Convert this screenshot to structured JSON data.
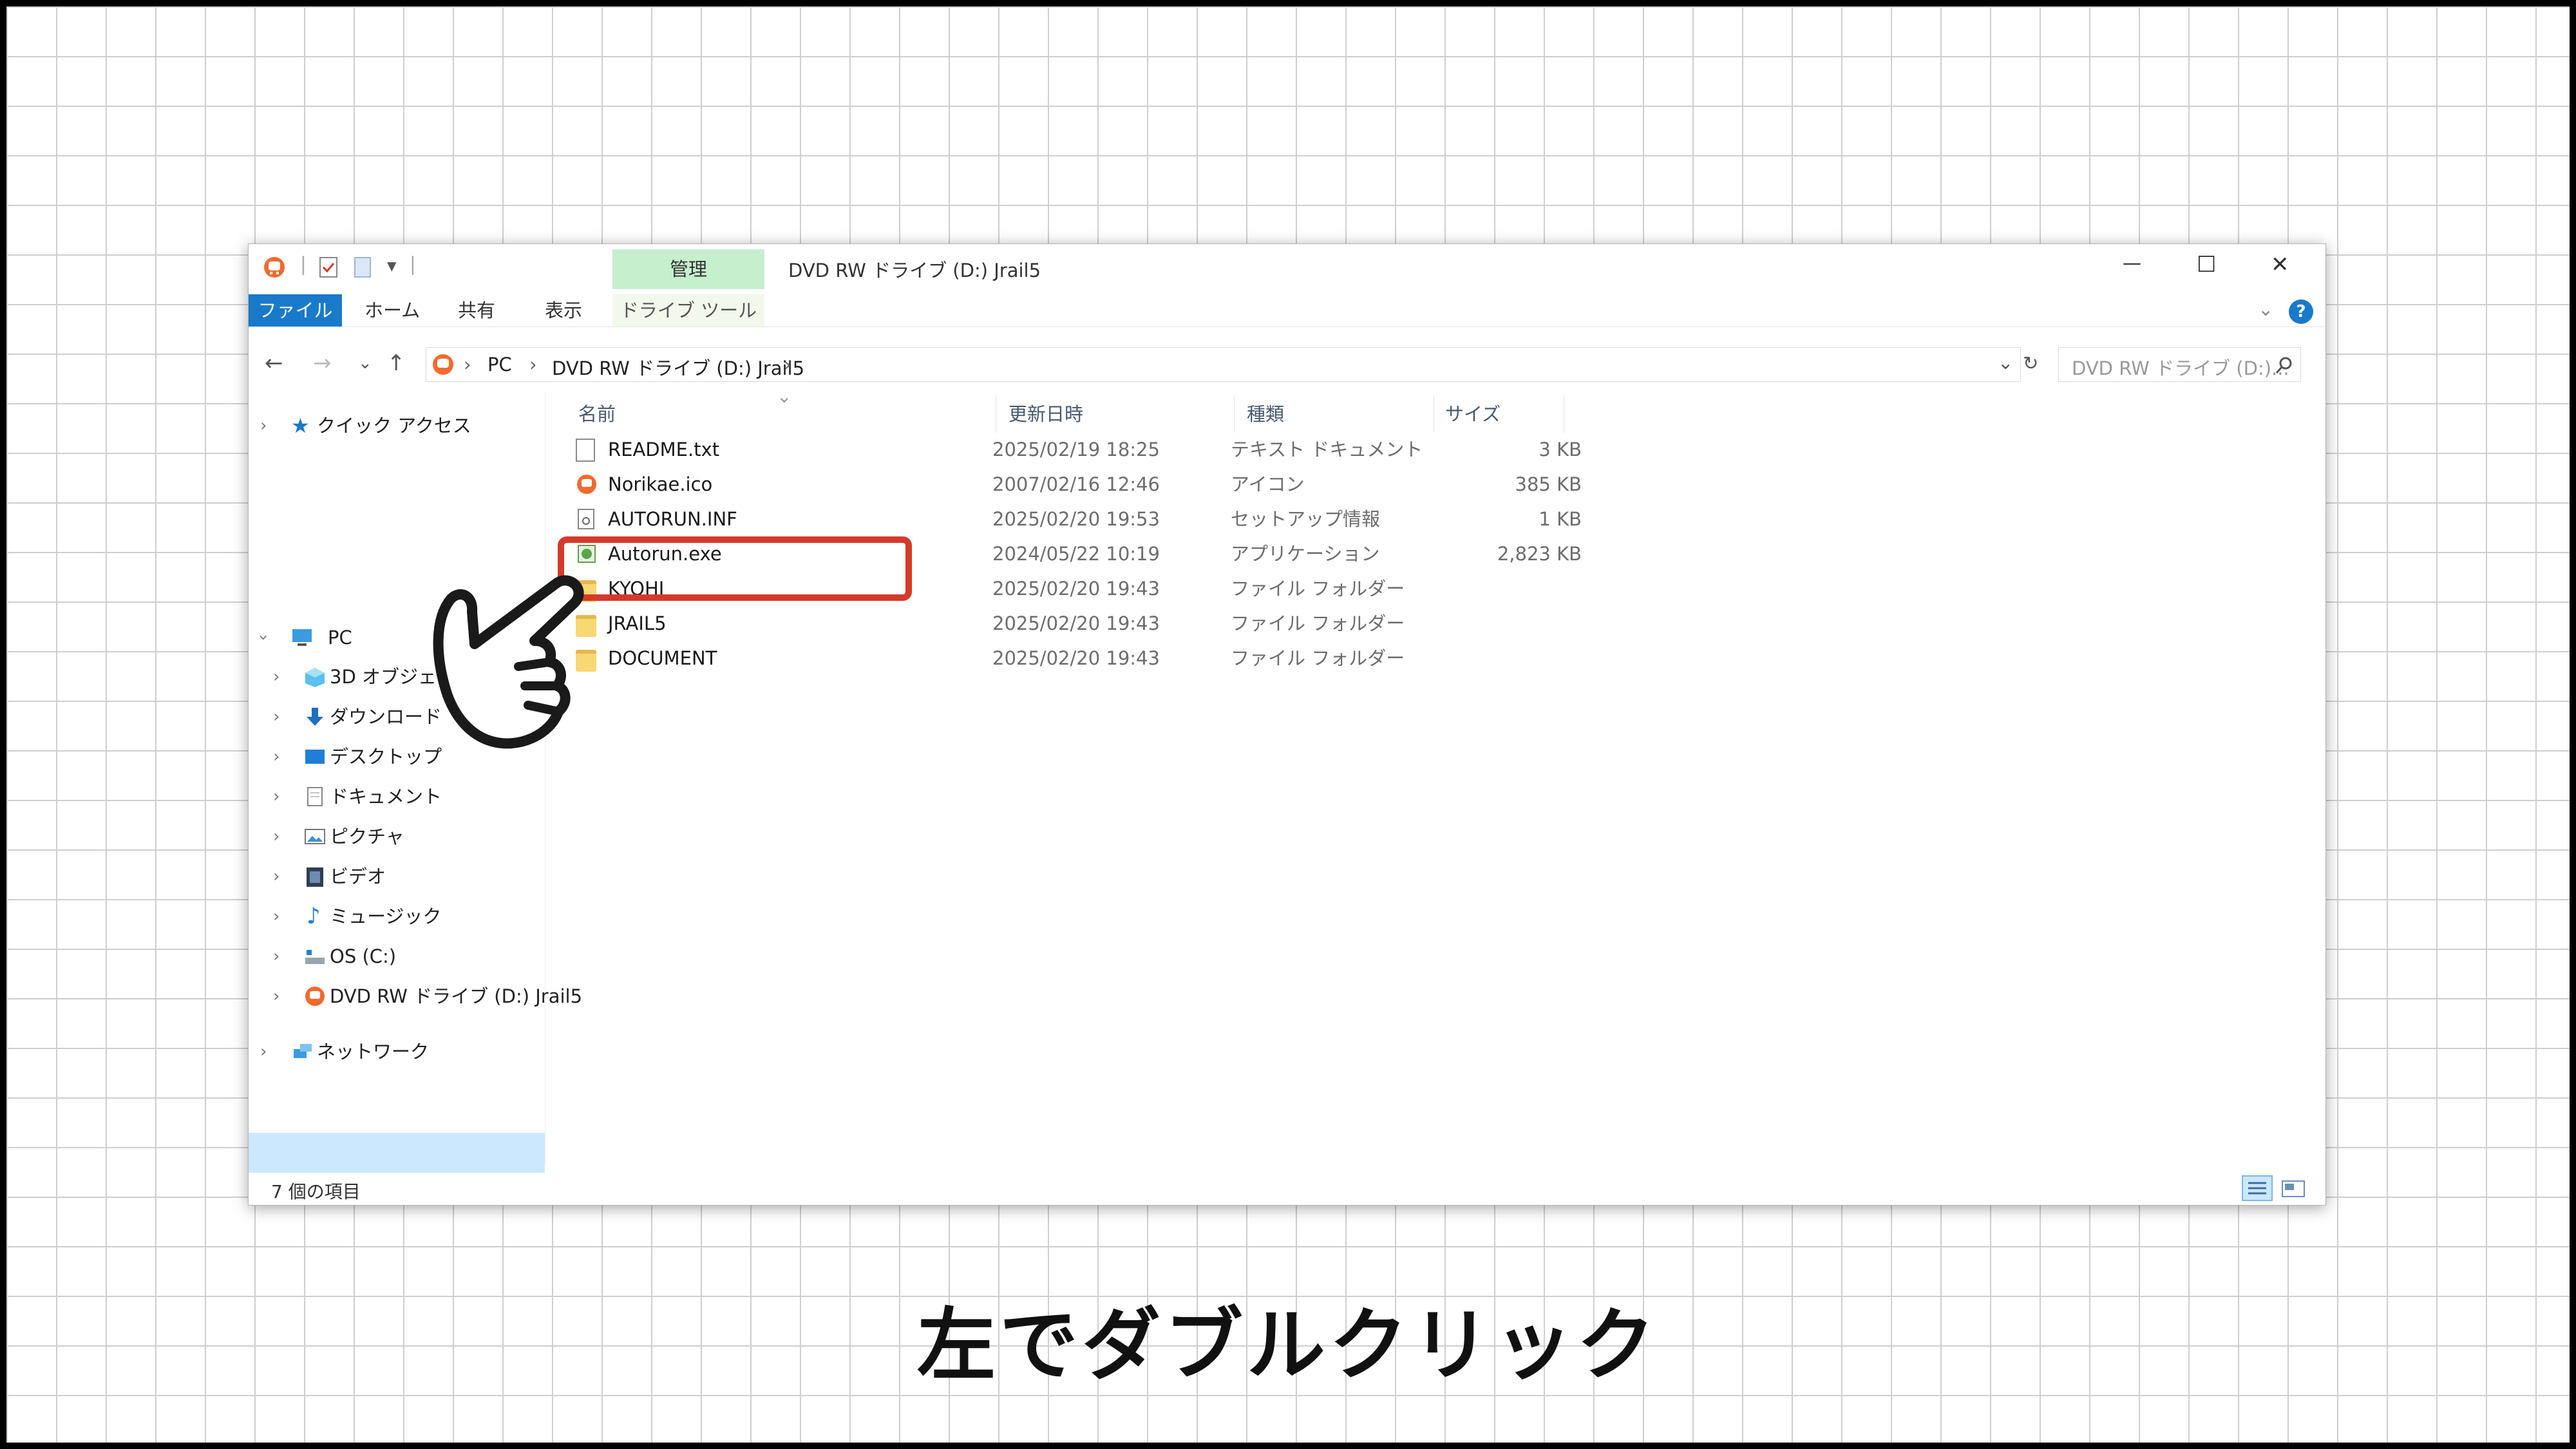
{
  "window": {
    "title": "DVD RW ドライブ (D:) Jrail5",
    "manage_tab": "管理",
    "drive_tools_tab": "ドライブ ツール",
    "ribbon_tabs": [
      "ファイル",
      "ホーム",
      "共有",
      "表示"
    ],
    "controls": {
      "minimize": "—",
      "maximize": "☐",
      "close": "✕",
      "help": "?",
      "expand": "⌄"
    }
  },
  "address": {
    "crumbs": [
      "PC",
      "DVD RW ドライブ (D:) Jrail5"
    ],
    "search_placeholder": "DVD RW ドライブ (D:)...",
    "nav": {
      "back": "←",
      "forward": "→",
      "recent": "⌄",
      "up": "↑",
      "refresh": "↻",
      "dropdown": "⌄"
    }
  },
  "nav_pane": {
    "quick_access": "クイック アクセス",
    "pc": "PC",
    "items": [
      "3D オブジェクト",
      "ダウンロード",
      "デスクトップ",
      "ドキュメント",
      "ピクチャ",
      "ビデオ",
      "ミュージック",
      "OS (C:)",
      "DVD RW ドライブ (D:) Jrail5"
    ],
    "network": "ネットワーク"
  },
  "columns": {
    "name": "名前",
    "modified": "更新日時",
    "type": "種類",
    "size": "サイズ",
    "sort_indicator": "⌄"
  },
  "files": [
    {
      "name": "README.txt",
      "modified": "2025/02/19 18:25",
      "type": "テキスト ドキュメント",
      "size": "3 KB",
      "icon": "text-document-icon"
    },
    {
      "name": "Norikae.ico",
      "modified": "2007/02/16 12:46",
      "type": "アイコン",
      "size": "385 KB",
      "icon": "app-icon"
    },
    {
      "name": "AUTORUN.INF",
      "modified": "2025/02/20 19:53",
      "type": "セットアップ情報",
      "size": "1 KB",
      "icon": "settings-file-icon"
    },
    {
      "name": "Autorun.exe",
      "modified": "2024/05/22 10:19",
      "type": "アプリケーション",
      "size": "2,823 KB",
      "icon": "exe-icon"
    },
    {
      "name": "KYOHI",
      "modified": "2025/02/20 19:43",
      "type": "ファイル フォルダー",
      "size": "",
      "icon": "folder-icon"
    },
    {
      "name": "JRAIL5",
      "modified": "2025/02/20 19:43",
      "type": "ファイル フォルダー",
      "size": "",
      "icon": "folder-icon"
    },
    {
      "name": "DOCUMENT",
      "modified": "2025/02/20 19:43",
      "type": "ファイル フォルダー",
      "size": "",
      "icon": "folder-icon"
    }
  ],
  "status": {
    "count": "7 個の項目"
  },
  "caption": "左でダブルクリック",
  "colors": {
    "accent": "#1979ca",
    "highlight": "#d43a2a",
    "manage": "#c6efce",
    "selected": "#cce8ff"
  }
}
